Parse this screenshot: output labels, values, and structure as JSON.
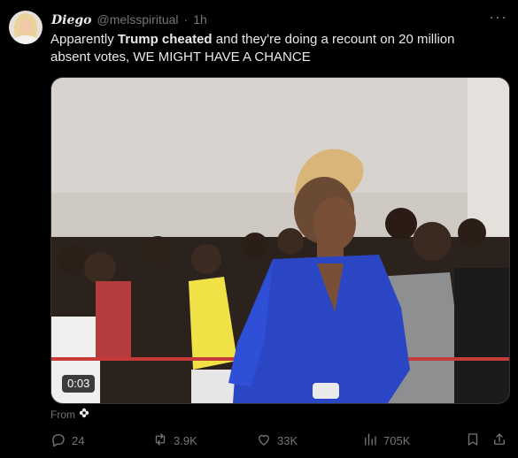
{
  "author": {
    "display_name": "Diego",
    "handle": "@melsspiritual",
    "separator": "·",
    "time": "1h"
  },
  "tweet": {
    "text_before": "Apparently ",
    "text_bold": "Trump cheated",
    "text_after": " and they're doing a recount on 20 million absent votes, WE MIGHT HAVE A CHANCE"
  },
  "media": {
    "duration": "0:03"
  },
  "source": {
    "label": "From"
  },
  "actions": {
    "replies": "24",
    "reposts": "3.9K",
    "likes": "33K",
    "views": "705K"
  },
  "icons": {
    "more": "more-dots-icon",
    "reply": "reply-bubble-icon",
    "repost": "repost-arrows-icon",
    "like": "heart-icon",
    "views": "bar-chart-icon",
    "bookmark": "bookmark-icon",
    "share": "share-upload-icon",
    "from": "flower-icon"
  },
  "colors": {
    "background": "#000000",
    "text": "#e7e9ea",
    "muted": "#71767b"
  }
}
